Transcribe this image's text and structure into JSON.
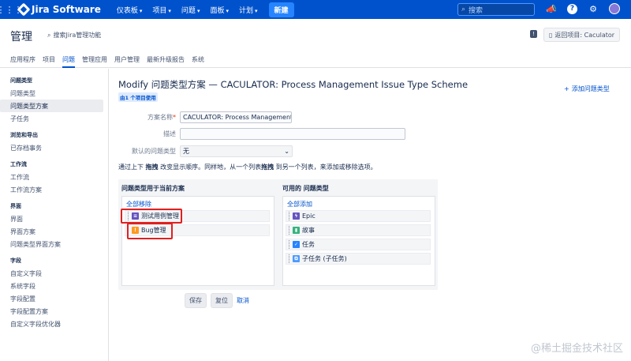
{
  "topnav": {
    "product": "Jira Software",
    "menu": [
      "仪表板",
      "项目",
      "问题",
      "面板",
      "计划"
    ],
    "create": "新建",
    "search_placeholder": "搜索"
  },
  "admin": {
    "title": "管理",
    "search": "搜索Jira管理功能",
    "back": "返回项目: Caculator",
    "tabs": [
      "应用程序",
      "项目",
      "问题",
      "管理应用",
      "用户管理",
      "最新升级报告",
      "系统"
    ],
    "active_tab": 2
  },
  "sidebar": {
    "groups": [
      {
        "header": "问题类型",
        "items": [
          "问题类型",
          "问题类型方案",
          "子任务"
        ]
      },
      {
        "header": "浏览和导出",
        "items": [
          "已存档事务"
        ]
      },
      {
        "header": "工作流",
        "items": [
          "工作流",
          "工作流方案"
        ]
      },
      {
        "header": "界面",
        "items": [
          "界面",
          "界面方案",
          "问题类型界面方案"
        ]
      },
      {
        "header": "字段",
        "items": [
          "自定义字段",
          "系统字段",
          "字段配置",
          "字段配置方案",
          "自定义字段优化器"
        ]
      }
    ]
  },
  "main": {
    "heading": "Modify 问题类型方案 — CACULATOR: Process Management Issue Type Scheme",
    "used_by": "由1 个项目使用",
    "add_type": "添加问题类型",
    "form": {
      "name_label": "方案名称",
      "name_value": "CACULATOR: Process Management Issue Type Scheme",
      "desc_label": "描述",
      "desc_value": "",
      "default_label": "默认的问题类型",
      "default_value": "无"
    },
    "instr_1": "通过上下 ",
    "instr_drag": "拖拽",
    "instr_2": " 改变显示顺序。同样地，从一个列表",
    "instr_drag2": "拖拽",
    "instr_3": " 到另一个列表，来添加或移除选项。",
    "left": {
      "header": "问题类型用于当前方案",
      "link": "全部移除",
      "items": [
        "测试用例管理",
        "Bug管理"
      ]
    },
    "right": {
      "header": "可用的 问题类型",
      "link": "全部添加",
      "items": [
        "Epic",
        "故事",
        "任务",
        "子任务 (子任务)"
      ]
    },
    "buttons": {
      "save": "保存",
      "reset": "复位",
      "cancel": "取消"
    }
  },
  "watermark": "@稀土掘金技术社区",
  "colors": {
    "nav": "#0052cc",
    "link": "#0052cc",
    "highlight": "#e02020"
  }
}
